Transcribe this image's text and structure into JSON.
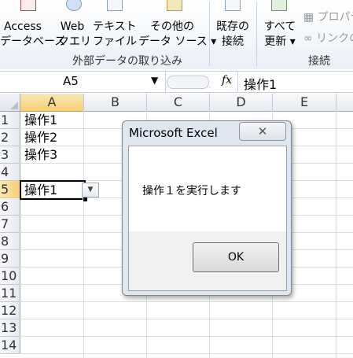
{
  "ribbon": {
    "buttons": [
      {
        "line1": "Access",
        "line2": "データベース"
      },
      {
        "line1": "Web",
        "line2": "クエリ"
      },
      {
        "line1": "テキスト",
        "line2": "ファイル"
      },
      {
        "line1": "その他の",
        "line2": "データ ソース ▾"
      },
      {
        "line1": "既存の",
        "line2": "接続"
      },
      {
        "line1": "すべて",
        "line2": "更新 ▾"
      }
    ],
    "connection_items": [
      "プロパテ",
      "リンクの"
    ],
    "group_external": "外部データの取り込み",
    "group_connections": "接続"
  },
  "formula_bar": {
    "name_box": "A5",
    "fx": "fx",
    "content": "操作1"
  },
  "columns": [
    "A",
    "B",
    "C",
    "D",
    "E"
  ],
  "rows": [
    "1",
    "2",
    "3",
    "4",
    "5",
    "6",
    "7",
    "8",
    "9",
    "10",
    "11",
    "12",
    "13",
    "14"
  ],
  "cells": {
    "A1": "操作1",
    "A2": "操作2",
    "A3": "操作3",
    "A5": "操作1"
  },
  "dialog": {
    "title": "Microsoft Excel",
    "close_glyph": "✕",
    "message": "操作１を実行します",
    "ok": "OK"
  }
}
